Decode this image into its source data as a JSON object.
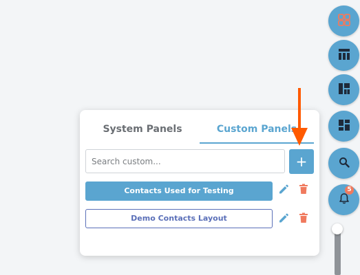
{
  "panel": {
    "tabs": [
      {
        "label": "System Panels",
        "active": false
      },
      {
        "label": "Custom Panels",
        "active": true
      }
    ],
    "search": {
      "placeholder": "Search custom...",
      "value": ""
    },
    "add_label": "+",
    "layouts": [
      {
        "label": "Contacts Used for Testing",
        "selected": true
      },
      {
        "label": "Demo Contacts Layout",
        "selected": false
      }
    ],
    "row_actions": {
      "edit_icon": "pencil-icon",
      "delete_icon": "trash-icon"
    }
  },
  "toolbar": {
    "buttons": [
      {
        "icon": "widgets-icon"
      },
      {
        "icon": "table-layout-icon"
      },
      {
        "icon": "panel-layout-icon"
      },
      {
        "icon": "dashboard-icon"
      },
      {
        "icon": "search-icon"
      },
      {
        "icon": "bell-icon",
        "badge": "5"
      }
    ]
  },
  "colors": {
    "accent": "#5aa5d0",
    "delete": "#f07a5e",
    "arrow": "#ff5a00",
    "outline_button": "#5a6fb8"
  }
}
